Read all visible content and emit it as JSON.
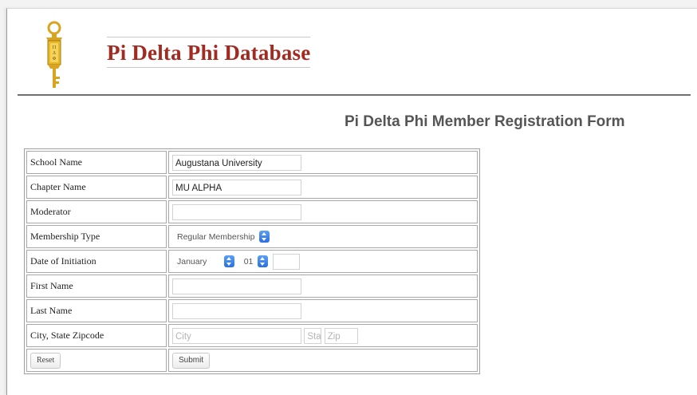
{
  "site": {
    "title": "Pi Delta Phi Database"
  },
  "form": {
    "title": "Pi Delta Phi Member Registration Form",
    "fields": {
      "school_name": {
        "label": "School Name",
        "value": "Augustana University"
      },
      "chapter_name": {
        "label": "Chapter Name",
        "value": "MU ALPHA"
      },
      "moderator": {
        "label": "Moderator",
        "value": ""
      },
      "membership_type": {
        "label": "Membership Type",
        "value": "Regular Membership"
      },
      "date_of_initiation": {
        "label": "Date of Initiation",
        "month": "January",
        "day": "01",
        "year": ""
      },
      "first_name": {
        "label": "First Name",
        "value": ""
      },
      "last_name": {
        "label": "Last Name",
        "value": ""
      },
      "city_state_zip": {
        "label": "City, State Zipcode",
        "city_placeholder": "City",
        "state_placeholder": "Sta",
        "zip_placeholder": "Zip"
      }
    },
    "buttons": {
      "reset": "Reset",
      "submit": "Submit"
    }
  },
  "colors": {
    "site_title": "#a32a20",
    "form_title": "#555555",
    "stepper": "#2a6fe0",
    "logo_gold": "#d9a520"
  },
  "icons": {
    "logo": "gold-key-emblem-icon",
    "stepper": "select-stepper-icon"
  }
}
